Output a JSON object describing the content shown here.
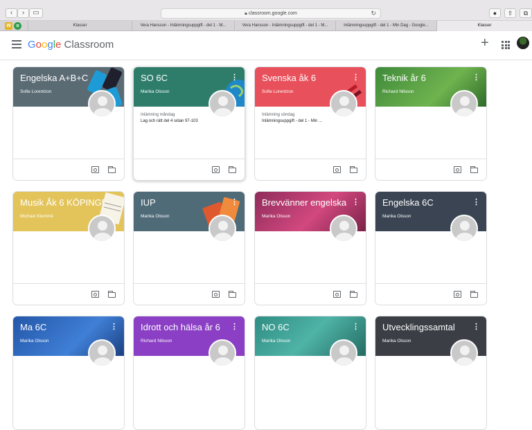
{
  "browser": {
    "url": "classroom.google.com",
    "tabs": [
      {
        "label": "Klasser",
        "active": false
      },
      {
        "label": "Vera Hansson - Inlämningsuppgift - del 1 - M...",
        "active": false
      },
      {
        "label": "Vera Hansson - Inlämningsuppgift - del 1 - M...",
        "active": false
      },
      {
        "label": "Inlämningsuppgift - del 1 - Min Dag - Google...",
        "active": false
      },
      {
        "label": "Klasser",
        "active": true
      }
    ]
  },
  "header": {
    "brand_google": "Google",
    "brand_product": " Classroom"
  },
  "cards": [
    {
      "title": "Engelska A+B+C",
      "teacher": "Sofie Lorentzon",
      "color": "#5b6b74",
      "assignment_due": "",
      "assignment_title": ""
    },
    {
      "title": "SO 6C",
      "teacher": "Marika Olsson",
      "color": "#2e7d6b",
      "assignment_due": "Inlämning måndag",
      "assignment_title": "Lag och rätt del 4 sidan 97-103"
    },
    {
      "title": "Svenska åk 6",
      "teacher": "Sofie Lorentzon",
      "color": "#e8505b",
      "assignment_due": "Inlämning söndag",
      "assignment_title": "Inlämningsuppgift - del 1 - Min ..."
    },
    {
      "title": "Teknik år 6",
      "teacher": "Richard Nilsson",
      "color": "#3f8a3a",
      "assignment_due": "",
      "assignment_title": ""
    },
    {
      "title": "Musik Åk 6 KÖPINGE...",
      "teacher": "Michael Klemmé",
      "color": "#e3c45a",
      "assignment_due": "",
      "assignment_title": ""
    },
    {
      "title": "IUP",
      "teacher": "Marika Olsson",
      "color": "#4f6b78",
      "assignment_due": "",
      "assignment_title": ""
    },
    {
      "title": "Brevvänner engelska",
      "teacher": "Marika Olsson",
      "color": "#b33a6e",
      "assignment_due": "",
      "assignment_title": ""
    },
    {
      "title": "Engelska 6C",
      "teacher": "Marika Olsson",
      "color": "#3a4452",
      "assignment_due": "",
      "assignment_title": ""
    },
    {
      "title": "Ma 6C",
      "teacher": "Marika Olsson",
      "color": "#2457a8",
      "assignment_due": "",
      "assignment_title": ""
    },
    {
      "title": "Idrott och hälsa år 6",
      "teacher": "Richard Nilsson",
      "color": "#8a3fc4",
      "assignment_due": "",
      "assignment_title": ""
    },
    {
      "title": "NO 6C",
      "teacher": "Marika Olsson",
      "color": "#2f8d84",
      "assignment_due": "",
      "assignment_title": ""
    },
    {
      "title": "Utvecklingssamtal",
      "teacher": "Marika Olsson",
      "color": "#3b3e45",
      "assignment_due": "",
      "assignment_title": ""
    }
  ]
}
